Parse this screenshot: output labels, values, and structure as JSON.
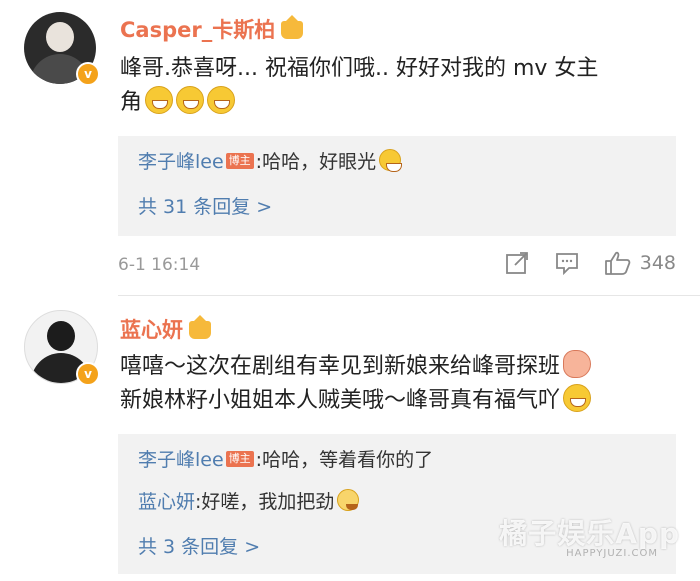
{
  "comments": [
    {
      "username": "Casper_卡斯柏",
      "text_lines": [
        "峰哥.恭喜呀... 祝福你们哦.. 好好对我的 mv 女主",
        "角"
      ],
      "emojis": [
        "laugh-emoji",
        "laugh-emoji",
        "laugh-emoji"
      ],
      "verified_badge": "v",
      "replies": [
        {
          "name": "李子峰lee",
          "badge": "博主",
          "text": ":哈哈，好眼光"
        }
      ],
      "more_replies": "共 31 条回复 >",
      "timestamp": "6-1 16:14",
      "like_count": "348"
    },
    {
      "username": "蓝心妍",
      "text_lines": [
        "嘻嘻～这次在剧组有幸见到新娘来给峰哥探班",
        "新娘林籽小姐姐本人贼美哦～峰哥真有福气吖"
      ],
      "verified_badge": "v",
      "replies": [
        {
          "name": "李子峰lee",
          "badge": "博主",
          "text": ":哈哈，等着看你的了"
        },
        {
          "name": "蓝心妍",
          "text": ":好嗟，我加把劲"
        }
      ],
      "more_replies": "共 3 条回复 >"
    }
  ],
  "watermark": {
    "text": "橘子娱乐App",
    "sub": "HAPPYJUZI.COM"
  },
  "colors": {
    "username": "#eb7350",
    "reply_name": "#507daf",
    "reply_bg": "#f2f2f2",
    "meta": "#999999"
  }
}
